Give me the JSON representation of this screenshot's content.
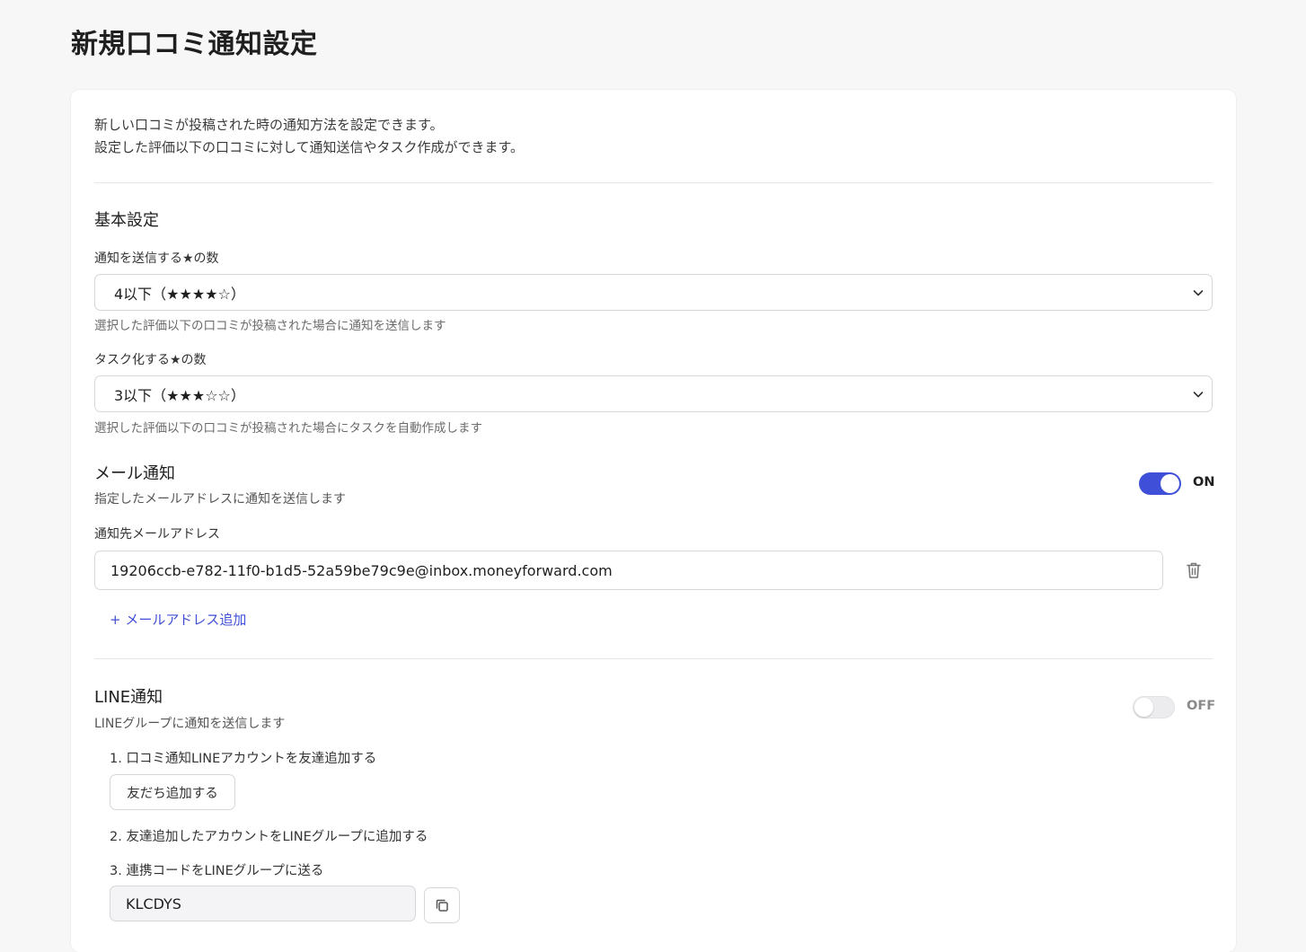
{
  "page": {
    "title": "新規口コミ通知設定"
  },
  "intro": {
    "line1": "新しい口コミが投稿された時の通知方法を設定できます。",
    "line2": "設定した評価以下の口コミに対して通知送信やタスク作成ができます。"
  },
  "basic": {
    "title": "基本設定",
    "notify_stars": {
      "label": "通知を送信する★の数",
      "value": "4以下（★★★★☆）",
      "help": "選択した評価以下の口コミが投稿された場合に通知を送信します"
    },
    "task_stars": {
      "label": "タスク化する★の数",
      "value": "3以下（★★★☆☆）",
      "help": "選択した評価以下の口コミが投稿された場合にタスクを自動作成します"
    }
  },
  "email": {
    "title": "メール通知",
    "description": "指定したメールアドレスに通知を送信します",
    "toggle_state": "ON",
    "field_label": "通知先メールアドレス",
    "addresses": [
      "19206ccb-e782-11f0-b1d5-52a59be79c9e@inbox.moneyforward.com"
    ],
    "add_label": "+ メールアドレス追加"
  },
  "line": {
    "title": "LINE通知",
    "description": "LINEグループに通知を送信します",
    "toggle_state": "OFF",
    "step1": "1. 口コミ通知LINEアカウントを友達追加する",
    "add_friend_label": "友だち追加する",
    "step2": "2. 友達追加したアカウントをLINEグループに追加する",
    "step3": "3. 連携コードをLINEグループに送る",
    "code": "KLCDYS"
  },
  "colors": {
    "accent": "#3f4fd8",
    "background": "#f7f7f8",
    "card": "#ffffff",
    "border": "#d6d6da"
  }
}
